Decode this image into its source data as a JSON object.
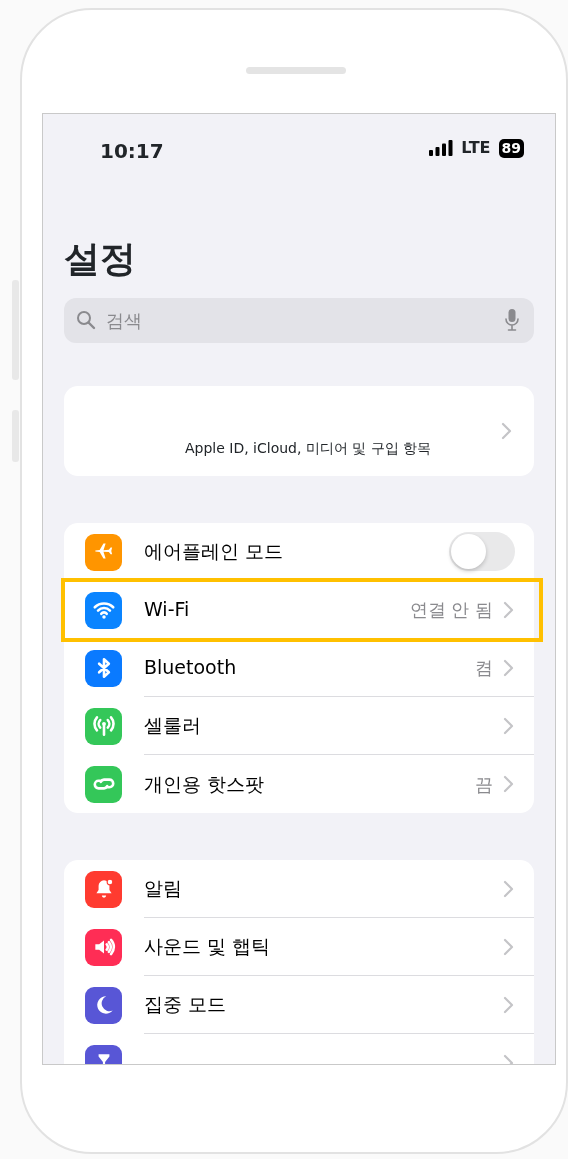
{
  "status_bar": {
    "time": "10:17",
    "network": "LTE",
    "battery": "89"
  },
  "title": "설정",
  "search": {
    "placeholder": "검색"
  },
  "account": {
    "subtitle": "Apple ID, iCloud, 미디어 및 구입 항목"
  },
  "groups": [
    {
      "rows": [
        {
          "kind": "toggle",
          "color": "#ff9500",
          "label": "에어플레인 모드",
          "on": false,
          "highlighted": false
        },
        {
          "kind": "link",
          "color": "#0a84ff",
          "label": "Wi-Fi",
          "value": "연결 안 됨",
          "highlighted": true
        },
        {
          "kind": "link",
          "color": "#0a7aff",
          "label": "Bluetooth",
          "value": "켬",
          "highlighted": false
        },
        {
          "kind": "link",
          "color": "#34c759",
          "label": "셀룰러",
          "highlighted": false
        },
        {
          "kind": "link",
          "color": "#34c759",
          "label": "개인용 핫스팟",
          "value": "끔",
          "highlighted": false
        }
      ]
    },
    {
      "rows": [
        {
          "kind": "link",
          "color": "#ff3b30",
          "label": "알림",
          "highlighted": false
        },
        {
          "kind": "link",
          "color": "#ff2d55",
          "label": "사운드 및 햅틱",
          "highlighted": false
        },
        {
          "kind": "link",
          "color": "#5856d6",
          "label": "집중 모드",
          "highlighted": false
        },
        {
          "kind": "link",
          "color": "#5856d6",
          "highlighted": false
        }
      ]
    }
  ]
}
